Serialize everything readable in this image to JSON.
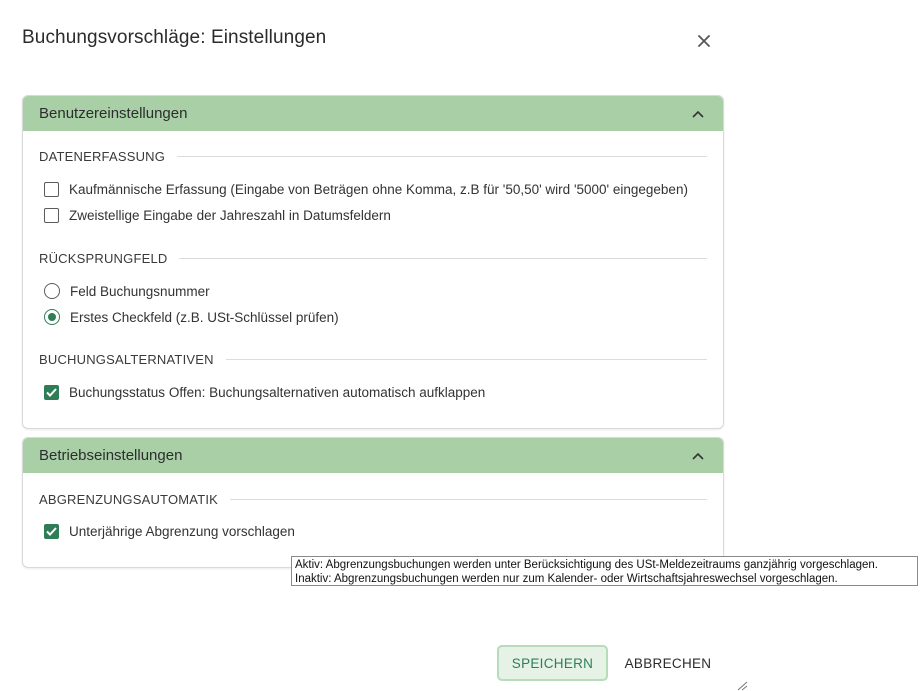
{
  "dialog": {
    "title": "Buchungsvorschläge: Einstellungen",
    "close_icon": "close-icon"
  },
  "panels": {
    "user": {
      "title": "Benutzereinstellungen",
      "expanded": true,
      "sections": {
        "datenerfassung": {
          "title": "DATENERFASSUNG",
          "options": [
            {
              "label": "Kaufmännische Erfassung (Eingabe von Beträgen ohne Komma, z.B für '50,50' wird '5000' eingegeben)",
              "checked": false
            },
            {
              "label": "Zweistellige Eingabe der Jahreszahl in Datumsfeldern",
              "checked": false
            }
          ]
        },
        "ruecksprungfeld": {
          "title": "RÜCKSPRUNGFELD",
          "options": [
            {
              "label": "Feld Buchungsnummer",
              "selected": false
            },
            {
              "label": "Erstes Checkfeld (z.B. USt-Schlüssel prüfen)",
              "selected": true
            }
          ]
        },
        "buchungsalternativen": {
          "title": "BUCHUNGSALTERNATIVEN",
          "options": [
            {
              "label": "Buchungsstatus Offen: Buchungsalternativen automatisch aufklappen",
              "checked": true
            }
          ]
        }
      }
    },
    "company": {
      "title": "Betriebseinstellungen",
      "expanded": true,
      "sections": {
        "abgrenzungsautomatik": {
          "title": "ABGRENZUNGSAUTOMATIK",
          "options": [
            {
              "label": "Unterjährige Abgrenzung vorschlagen",
              "checked": true
            }
          ]
        }
      }
    }
  },
  "tooltip": {
    "line1": "Aktiv: Abgrenzungsbuchungen werden unter Berücksichtigung des USt-Meldezeitraums ganzjährig vorgeschlagen.",
    "line2": "Inaktiv: Abgrenzungsbuchungen werden nur zum Kalender- oder Wirtschaftsjahreswechsel vorgeschlagen."
  },
  "footer": {
    "save_label": "SPEICHERN",
    "cancel_label": "ABBRECHEN"
  },
  "colors": {
    "panel_header": "#a8cfa6",
    "accent": "#2f7d57",
    "save_bg": "#e6f2e5"
  }
}
